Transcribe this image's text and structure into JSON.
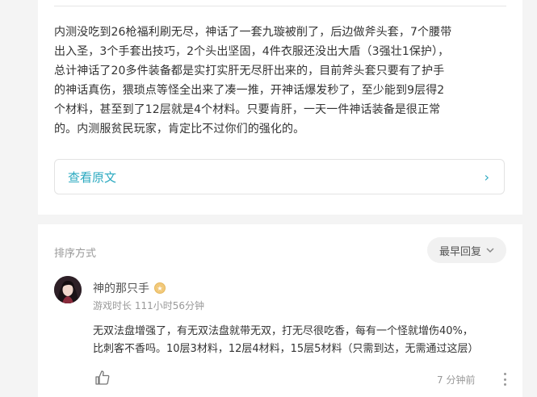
{
  "post": {
    "text": "内测没吃到26枪福利刷无尽，神话了一套九璇被削了，后边做斧头套，7个腰带\n出入圣，3个手套出技巧，2个头出坚固，4件衣服还没出大盾（3强壮1保护），\n总计神话了20多件装备都是实打实肝无尽肝出来的，目前斧头套只要有了护手\n的神话真伤，猥琐点等怪全出来了凑一推，开神话爆发秒了，至少能到9层得2\n个材料，甚至到了12层就是4个材料。只要肯肝，一天一件神话装备是很正常\n的。内测服贫民玩家，肯定比不过你们的强化的。",
    "view_original_label": "查看原文",
    "view_original_chevron": "›"
  },
  "comments": {
    "sort_label": "排序方式",
    "sort_button_label": "最早回复",
    "items": [
      {
        "username": "神的那只手",
        "playtime": "游戏时长 111小时56分钟",
        "text": "无双法盘增强了，有无双法盘就带无双，打无尽很吃香，每有一个怪就增伤40%，\n比刺客不香吗。10层3材料，12层4材料，15层5材料（只需到达，无需通过这层）",
        "time": "7 分钟前"
      }
    ]
  },
  "colors": {
    "accent": "#2aa9c0",
    "background": "#f4f4f4",
    "badge": "#f2c97a"
  }
}
